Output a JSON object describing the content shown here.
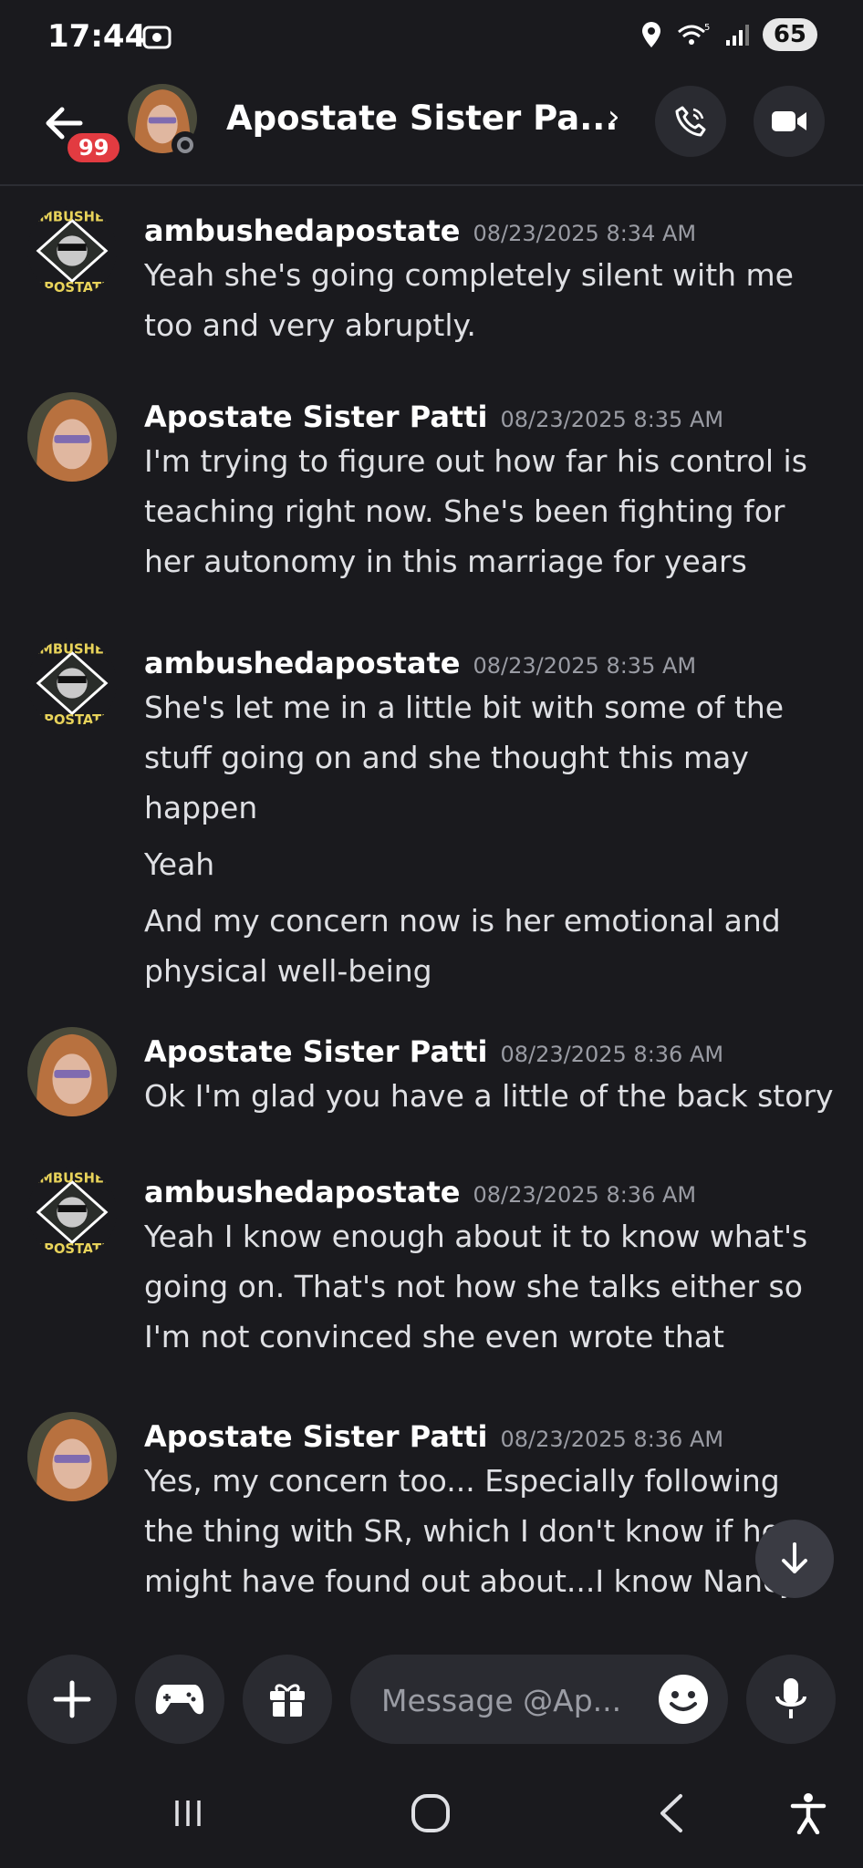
{
  "status_bar": {
    "time": "17:44",
    "battery": "65"
  },
  "header": {
    "title": "Apostate Sister Pa...",
    "unread_badge": "99"
  },
  "messages": [
    {
      "author": "ambushedapostate",
      "timestamp": "08/23/2025 8:34 AM",
      "avatar": "ambushed-apostate-logo",
      "lines": [
        "Yeah she's going completely silent with me",
        "too and very abruptly."
      ]
    },
    {
      "author": "Apostate Sister Patti",
      "timestamp": "08/23/2025 8:35 AM",
      "avatar": "patti-photo",
      "lines": [
        "I'm trying to figure out how far his control is",
        "teaching right now. She's been fighting for",
        "her autonomy in this marriage for years"
      ]
    },
    {
      "author": "ambushedapostate",
      "timestamp": "08/23/2025 8:35 AM",
      "avatar": "ambushed-apostate-logo",
      "lines": [
        "She's let me in a little bit with some of the",
        "stuff going on and she thought this may",
        "happen",
        "Yeah",
        "And my concern now is her emotional and",
        "physical well-being"
      ]
    },
    {
      "author": "Apostate Sister Patti",
      "timestamp": "08/23/2025 8:36 AM",
      "avatar": "patti-photo",
      "lines": [
        "Ok I'm glad you have a little of the back story"
      ]
    },
    {
      "author": "ambushedapostate",
      "timestamp": "08/23/2025 8:36 AM",
      "avatar": "ambushed-apostate-logo",
      "lines": [
        "Yeah I know enough about it to know what's",
        "going on. That's not how she talks either so",
        "I'm not convinced she even wrote that"
      ]
    },
    {
      "author": "Apostate Sister Patti",
      "timestamp": "08/23/2025 8:36 AM",
      "avatar": "patti-photo",
      "lines": [
        "Yes, my concern too... Especially following",
        "the thing with SR, which I don't know if he",
        "might have found out about...I know Nancy"
      ]
    }
  ],
  "logo_text": {
    "top": "AMBUSHED",
    "bottom": "APOSTATE"
  },
  "composer": {
    "placeholder": "Message @Ap..."
  },
  "colors": {
    "background": "#1a1a1e",
    "surface": "#2a2b31",
    "badge": "#e23b41",
    "timestamp": "#9a9ca4"
  }
}
